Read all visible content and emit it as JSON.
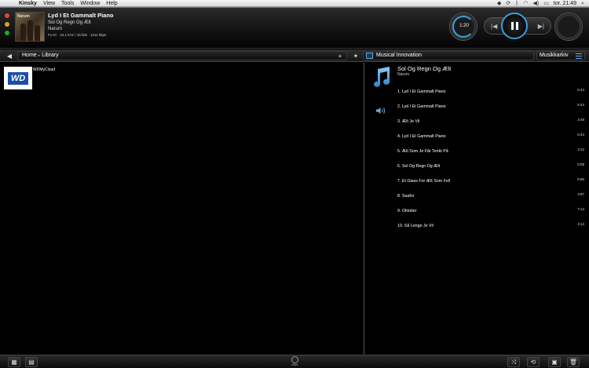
{
  "menubar": {
    "apple": "",
    "app_name": "Kinsky",
    "menus": [
      "View",
      "Tools",
      "Window",
      "Help"
    ],
    "clock": "tor. 21:49"
  },
  "now_playing": {
    "cover_text": "Narum",
    "track_title": "Lyd I Et Gammalt Piano",
    "album": "Sol Og Regn Og Ælt",
    "artist": "Narum",
    "format": "FLAC",
    "sample_rate": "44.1 kHz / 16 bits",
    "bitrate": "1411 kbps",
    "elapsed": "1:20"
  },
  "toolbar": {
    "breadcrumb_home": "Home",
    "breadcrumb_current": "Library",
    "add_symbol": "+",
    "room": "Musical Innovation",
    "source": "Musikkarkiv"
  },
  "library": {
    "items": [
      {
        "label": "WDMyCloud",
        "logo": "WD"
      }
    ]
  },
  "album_panel": {
    "title": "Sol Og Regn Og Ælt",
    "artist": "Narum",
    "tracks": [
      {
        "name": "1. Lyd I Et Gammalt Piano",
        "duration": "6:44"
      },
      {
        "name": "2. Lyd I Et Gammalt Piano",
        "duration": "6:44"
      },
      {
        "name": "3. Ælt Je Vil",
        "duration": "3:48"
      },
      {
        "name": "4. Lyd I Et Gammalt Piano",
        "duration": "6:44"
      },
      {
        "name": "5. Ælt Som Je Får Tenkt På",
        "duration": "3:12"
      },
      {
        "name": "6. Sol Og Regn Og Ælt",
        "duration": "5:09"
      },
      {
        "name": "7. Et Glass For Ælt Som Fell",
        "duration": "5:50"
      },
      {
        "name": "8. Saafor",
        "duration": "3:57"
      },
      {
        "name": "9. Oktober",
        "duration": "7:14"
      },
      {
        "name": "10. Så Lenge Je Vil",
        "duration": "3:14"
      }
    ]
  },
  "bottom": {
    "linn_label": "LINN"
  },
  "colors": {
    "accent": "#3aa0e0",
    "wd_blue": "#1a4fa8"
  }
}
